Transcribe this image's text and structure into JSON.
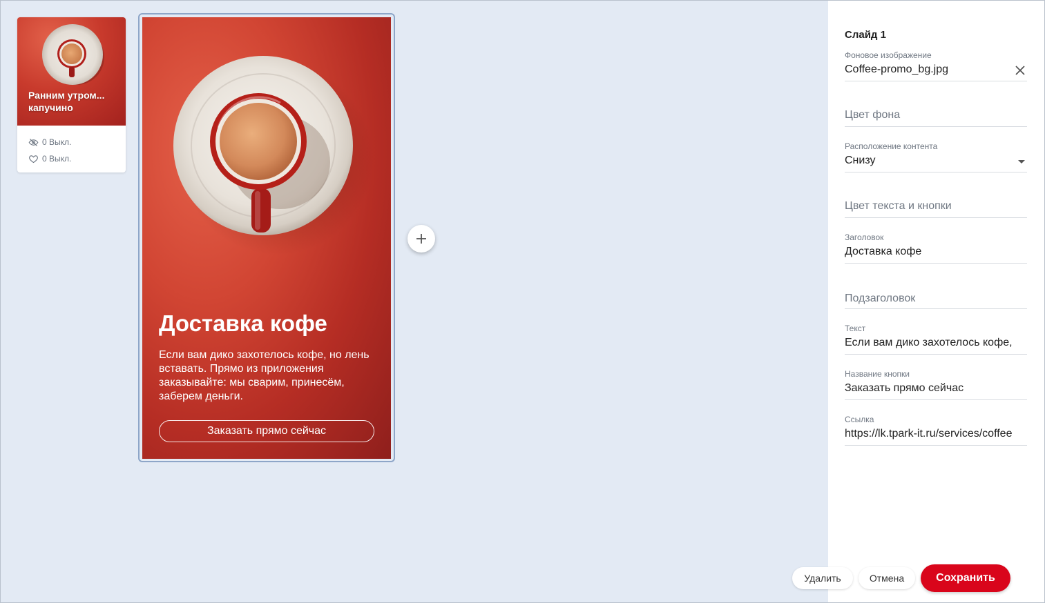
{
  "thumbnail": {
    "title_line1": "Ранним утром...",
    "title_line2": "капучино",
    "views_label": "0 Выкл.",
    "likes_label": "0 Выкл."
  },
  "preview": {
    "title": "Доставка кофе",
    "text": "Если вам дико захотелось кофе, но лень вставать. Прямо из приложения заказывайте: мы сварим, принесём, заберем деньги.",
    "button_label": "Заказать прямо сейчас"
  },
  "panel": {
    "title": "Слайд 1",
    "fields": {
      "bg_image": {
        "label": "Фоновое изображение",
        "value": "Coffee-promo_bg.jpg"
      },
      "bg_color": {
        "placeholder": "Цвет фона"
      },
      "layout": {
        "label": "Расположение контента",
        "value": "Снизу"
      },
      "text_color": {
        "placeholder": "Цвет текста и кнопки"
      },
      "heading": {
        "label": "Заголовок",
        "value": "Доставка кофе"
      },
      "subheading": {
        "placeholder": "Подзаголовок"
      },
      "body": {
        "label": "Текст",
        "value": "Если вам дико захотелось кофе,"
      },
      "button_name": {
        "label": "Название кнопки",
        "value": "Заказать прямо сейчас"
      },
      "link": {
        "label": "Ссылка",
        "value": "https://lk.tpark-it.ru/services/coffee"
      }
    }
  },
  "actions": {
    "delete_label": "Удалить",
    "cancel_label": "Отмена",
    "save_label": "Сохранить"
  },
  "colors": {
    "accent": "#d9051b",
    "canvas_bg": "#e3eaf4",
    "slide_red": "#c83a2c"
  },
  "icons": {
    "views": "eye-off-icon",
    "likes": "heart-icon",
    "add": "plus-icon",
    "clear": "close-icon",
    "dropdown": "caret-down-icon"
  }
}
